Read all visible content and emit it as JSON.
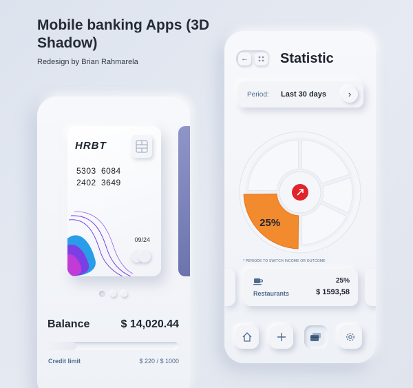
{
  "hero": {
    "title": "Mobile banking Apps (3D Shadow)",
    "subtitle": "Redesign by Brian Rahmarela"
  },
  "card": {
    "brand": "HRBT",
    "number_line1": [
      "5303",
      "6084"
    ],
    "number_line2": [
      "2402",
      "3649"
    ],
    "expiry": "09/24",
    "carousel_active_index": 0,
    "carousel_count": 3,
    "accent_colors": [
      "#2a9de8",
      "#7b3fe4",
      "#c13bd6"
    ]
  },
  "balance": {
    "label": "Balance",
    "value": "$ 14,020.44",
    "credit_label": "Credit limit",
    "credit_value": "$ 220 / $ 1000",
    "credit_fraction": 0.22
  },
  "statistic": {
    "title": "Statistic",
    "period_label": "Period:",
    "period_value": "Last 30 days",
    "slices": [
      {
        "value": 25,
        "label": "25%",
        "color": "#f28a2e",
        "highlight": true
      },
      {
        "value": 25,
        "color": "#f7f8fb"
      },
      {
        "value": 20,
        "color": "#f7f8fb"
      },
      {
        "value": 12,
        "color": "#f7f8fb"
      },
      {
        "value": 18,
        "color": "#f7f8fb"
      }
    ],
    "center_icon": "arrow-up-right-icon",
    "center_color": "#e0242a",
    "hint": "* PERIODE TO SWITCH INCOME OR OUTCOME",
    "transaction": {
      "category": "Restaurants",
      "percent": "25%",
      "amount": "$ 1593,58",
      "icon": "coffee-cup-icon"
    }
  },
  "bottom_nav": [
    "home-icon",
    "plus-icon",
    "cards-icon",
    "settings-icon"
  ],
  "colors": {
    "accent_text": "#4f6a8c",
    "highlight_orange": "#f28a2e",
    "side_card": "#7b83bb"
  }
}
